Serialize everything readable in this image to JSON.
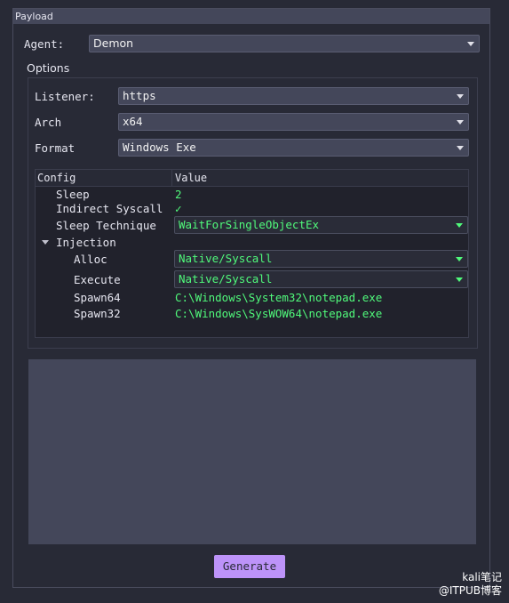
{
  "window": {
    "title": "Payload"
  },
  "agent": {
    "label": "Agent:",
    "value": "Demon"
  },
  "options": {
    "title": "Options",
    "listener": {
      "label": "Listener:",
      "value": "https"
    },
    "arch": {
      "label": "Arch",
      "value": "x64"
    },
    "format": {
      "label": "Format",
      "value": "Windows Exe"
    }
  },
  "config": {
    "headers": {
      "config": "Config",
      "value": "Value"
    },
    "sleep": {
      "label": "Sleep",
      "value": "2"
    },
    "indirect_syscall": {
      "label": "Indirect Syscall",
      "value": "✓"
    },
    "sleep_technique": {
      "label": "Sleep Technique",
      "value": "WaitForSingleObjectEx"
    },
    "injection": {
      "label": "Injection"
    },
    "alloc": {
      "label": "Alloc",
      "value": "Native/Syscall"
    },
    "execute": {
      "label": "Execute",
      "value": "Native/Syscall"
    },
    "spawn64": {
      "label": "Spawn64",
      "value": "C:\\Windows\\System32\\notepad.exe"
    },
    "spawn32": {
      "label": "Spawn32",
      "value": "C:\\Windows\\SysWOW64\\notepad.exe"
    }
  },
  "generate": {
    "label": "Generate"
  },
  "watermark": {
    "line1": "kali笔记",
    "line2": "@ITPUB博客"
  },
  "colors": {
    "accent": "#bd93f9",
    "value_green": "#50fa7b",
    "background": "#282a36"
  }
}
